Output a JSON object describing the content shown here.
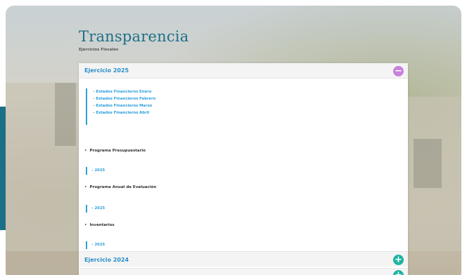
{
  "page": {
    "title": "Transparencia",
    "subtitle": "Ejercicios Fiscales"
  },
  "accordion": [
    {
      "label": "Ejercicio 2025",
      "expanded": true,
      "links": [
        "– Estados Financieros Enero",
        "– Estados Financieros Febrero",
        "– Estados Financieros Marzo",
        "– Estados Financieros Abril"
      ],
      "sections": [
        {
          "label": "Programa Presupuestario",
          "items": [
            "– 2025"
          ]
        },
        {
          "label": "Programa Anual de Evaluación",
          "items": [
            "– 2025"
          ]
        },
        {
          "label": "Inventarios",
          "items": [
            "– 2025"
          ]
        }
      ]
    },
    {
      "label": "Ejercicio 2024",
      "expanded": false
    }
  ],
  "icons": {
    "collapse": "minus-icon",
    "expand": "plus-icon",
    "bullet": "•"
  },
  "colors": {
    "title": "#1d6f89",
    "link": "#2d9fdc",
    "collapse_toggle": "#c782db",
    "expand_toggle": "#1fb3a1",
    "side_strip": "#1b6f86"
  }
}
